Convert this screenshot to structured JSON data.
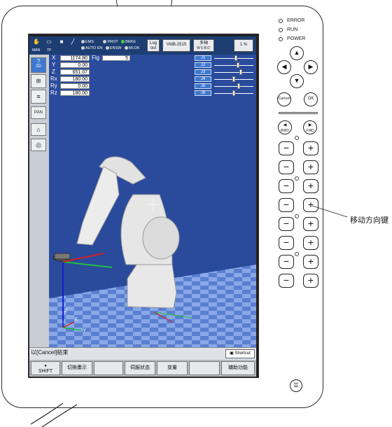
{
  "topbar": {
    "hand_label": "MAN",
    "tp_label": "TP",
    "indicators": {
      "row1": [
        "EMS",
        "PROT",
        "BRKE"
      ],
      "row2": [
        "AUTO EN",
        "ENSW",
        "MLOK"
      ]
    },
    "logout_label": "Log out",
    "robot_model": "VMB-2515",
    "multi_axis_label": "多轴",
    "multi_axis_sub": "WORD",
    "speed": "1 %"
  },
  "sidebar": {
    "view3d": "3D",
    "pan": "PAN"
  },
  "coordinates": [
    {
      "label": "X",
      "value": "1174.80"
    },
    {
      "label": "Y",
      "value": "0.00"
    },
    {
      "label": "Z",
      "value": "651.07"
    },
    {
      "label": "Rx",
      "value": "180.00"
    },
    {
      "label": "Ry",
      "value": "0.00"
    },
    {
      "label": "Rz",
      "value": "180.00"
    }
  ],
  "fig": {
    "label": "Fig",
    "value": "5"
  },
  "joints": [
    {
      "label": "J1",
      "level": 0.55
    },
    {
      "label": "J2",
      "level": 0.62
    },
    {
      "label": "J3",
      "level": 0.7
    },
    {
      "label": "J4",
      "level": 0.5
    },
    {
      "label": "J5",
      "level": 0.64
    },
    {
      "label": "J6",
      "level": 0.5
    }
  ],
  "axes3d": {
    "x": "X",
    "y": "Y",
    "z": "Z"
  },
  "status": {
    "message": "以[Cancel]結束",
    "shortcut_label": "Shortcut"
  },
  "fkeys": [
    "SHIFT",
    "切換畫示",
    "",
    "伺服状态",
    "变量",
    "",
    "辅助功能"
  ],
  "leds": [
    "ERROR",
    "RUN",
    "POWER"
  ],
  "nav": {
    "up": "▲",
    "left": "◀",
    "right": "▶",
    "down": "▼"
  },
  "cancel_label": "Cancel",
  "ok_label": "OK",
  "bwd_label": "BWD",
  "fwd_label": "FWD",
  "jog_rows": 8,
  "minus_glyph": "−",
  "plus_glyph": "+",
  "callout_label": "移动方向键",
  "menu_glyph": "☰",
  "colors": {
    "screen_bg": "#2a4a9c",
    "topbar": "#1d3e73",
    "joint_btn": "#3f78d0"
  }
}
